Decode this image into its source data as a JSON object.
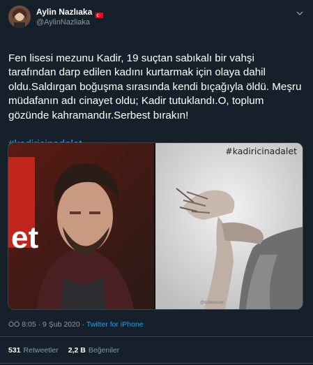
{
  "author": {
    "display_name": "Aylin Nazlıaka",
    "handle": "@AylinNazliaka"
  },
  "icons": {
    "flag": "turkey-flag-icon",
    "caret": "chevron-down-icon"
  },
  "tweet": {
    "text": "Fen lisesi mezunu Kadir, 19 suçtan sabıkalı bir vahşi tarafından darp edilen kadını kurtarmak için olaya dahil oldu.Saldırgan boğuşma sırasında kendi bıçağıyla öldü. Meşru müdafanın adı cinayet oldu; Kadir tutuklandı.O, toplum gözünde kahramandır.Serbest bırakın!",
    "hashtag": "#kadiricinadalet"
  },
  "media": {
    "image_hashtag": "#kadiricinadalet",
    "left_panel_text": "et",
    "credit": "@ozlemozen"
  },
  "meta": {
    "time": "ÖÖ 8:05",
    "dot": "·",
    "date": "9 Şub 2020",
    "source": "Twitter for iPhone"
  },
  "stats": {
    "retweets_count": "531",
    "retweets_label": "Retweetler",
    "likes_count": "2,2 B",
    "likes_label": "Beğeniler"
  },
  "colors": {
    "background": "#15202b",
    "accent": "#1da1f2",
    "muted": "#8899a6",
    "divider": "#38444d"
  }
}
